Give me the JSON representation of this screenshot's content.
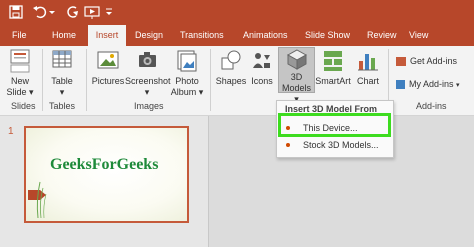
{
  "tabs": [
    "File",
    "Home",
    "Insert",
    "Design",
    "Transitions",
    "Animations",
    "Slide Show",
    "Review",
    "View"
  ],
  "active_tab": "Insert",
  "ribbon": {
    "new_slide": [
      "New",
      "Slide ▾"
    ],
    "table": [
      "Table",
      "▾"
    ],
    "pictures": "Pictures",
    "screenshot": [
      "Screenshot",
      "▾"
    ],
    "photo_album": [
      "Photo",
      "Album ▾"
    ],
    "shapes": "Shapes",
    "icons": "Icons",
    "models_3d": [
      "3D",
      "Models ▾"
    ],
    "smartart": "SmartArt",
    "chart": "Chart",
    "get_addins": "Get Add-ins",
    "my_addins": "My Add-ins",
    "groups": [
      "Slides",
      "Tables",
      "Images",
      "Add-ins"
    ]
  },
  "dropdown": {
    "header": "Insert 3D Model From",
    "items": [
      "This Device...",
      "Stock 3D Models..."
    ]
  },
  "slide": {
    "number": "1",
    "title": "GeeksForGeeks"
  },
  "colors": {
    "accent": "#b7472a",
    "title_green": "#1e8a3a",
    "highlight": "#3ddc1f"
  }
}
